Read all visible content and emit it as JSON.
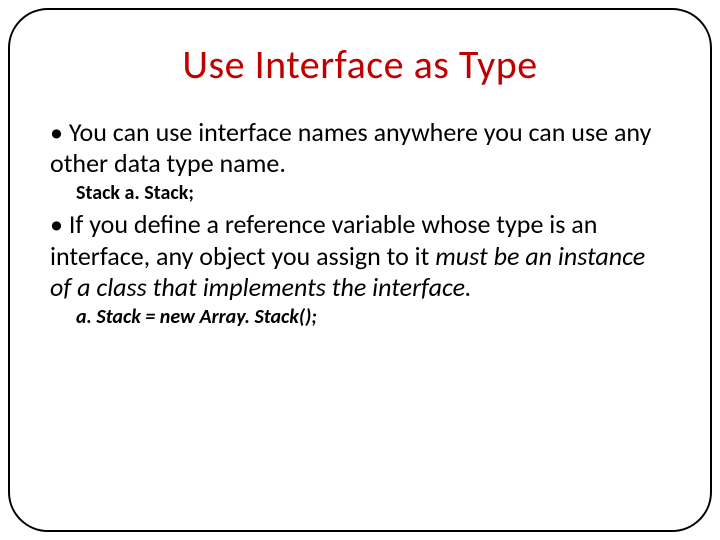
{
  "title": "Use Interface as Type",
  "bullet1_pre": "• You can use interface names anywhere you can use any other data type name.",
  "code1": "Stack a. Stack;",
  "bullet2_pre": "• If you define a reference variable whose type is an interface, any object you assign to it ",
  "bullet2_italic": "must be an instance of a class that implements the interface.",
  "code2": "a. Stack = new Array. Stack();"
}
